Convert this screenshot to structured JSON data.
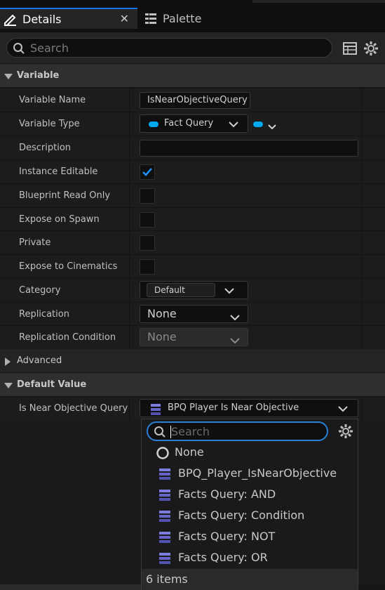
{
  "tabs": [
    {
      "label": "Details",
      "icon": "pencil-icon",
      "active": true
    },
    {
      "label": "Palette",
      "icon": "list-icon",
      "active": false
    }
  ],
  "search": {
    "placeholder": "Search"
  },
  "sections": {
    "variable": "Variable",
    "advanced": "Advanced",
    "default_value": "Default Value"
  },
  "rows": {
    "variable_name": {
      "label": "Variable Name",
      "value": "IsNearObjectiveQuery"
    },
    "variable_type": {
      "label": "Variable Type",
      "value": "Fact Query"
    },
    "description": {
      "label": "Description",
      "value": ""
    },
    "instance_editable": {
      "label": "Instance Editable",
      "checked": true
    },
    "blueprint_read_only": {
      "label": "Blueprint Read Only",
      "checked": false
    },
    "expose_on_spawn": {
      "label": "Expose on Spawn",
      "checked": false
    },
    "private": {
      "label": "Private",
      "checked": false
    },
    "expose_to_cinematics": {
      "label": "Expose to Cinematics",
      "checked": false
    },
    "category": {
      "label": "Category",
      "value": "Default"
    },
    "replication": {
      "label": "Replication",
      "value": "None"
    },
    "replication_condition": {
      "label": "Replication Condition",
      "value": "None"
    },
    "is_near_objective_query": {
      "label": "Is Near Objective Query",
      "value": "BPQ Player Is Near Objective"
    }
  },
  "dropdown": {
    "search_placeholder": "Search",
    "items": [
      {
        "label": "None",
        "icon": "circle-icon"
      },
      {
        "label": "BPQ_Player_IsNearObjective",
        "icon": "asset-stack-icon"
      },
      {
        "label": "Facts Query: AND",
        "icon": "asset-stack-icon"
      },
      {
        "label": "Facts Query: Condition",
        "icon": "asset-stack-icon"
      },
      {
        "label": "Facts Query: NOT",
        "icon": "asset-stack-icon"
      },
      {
        "label": "Facts Query: OR",
        "icon": "asset-stack-icon"
      }
    ],
    "footer": "6 items"
  },
  "colors": {
    "accent": "#1473e6",
    "pin": "#00a8f0",
    "background": "#1c1c1c"
  }
}
